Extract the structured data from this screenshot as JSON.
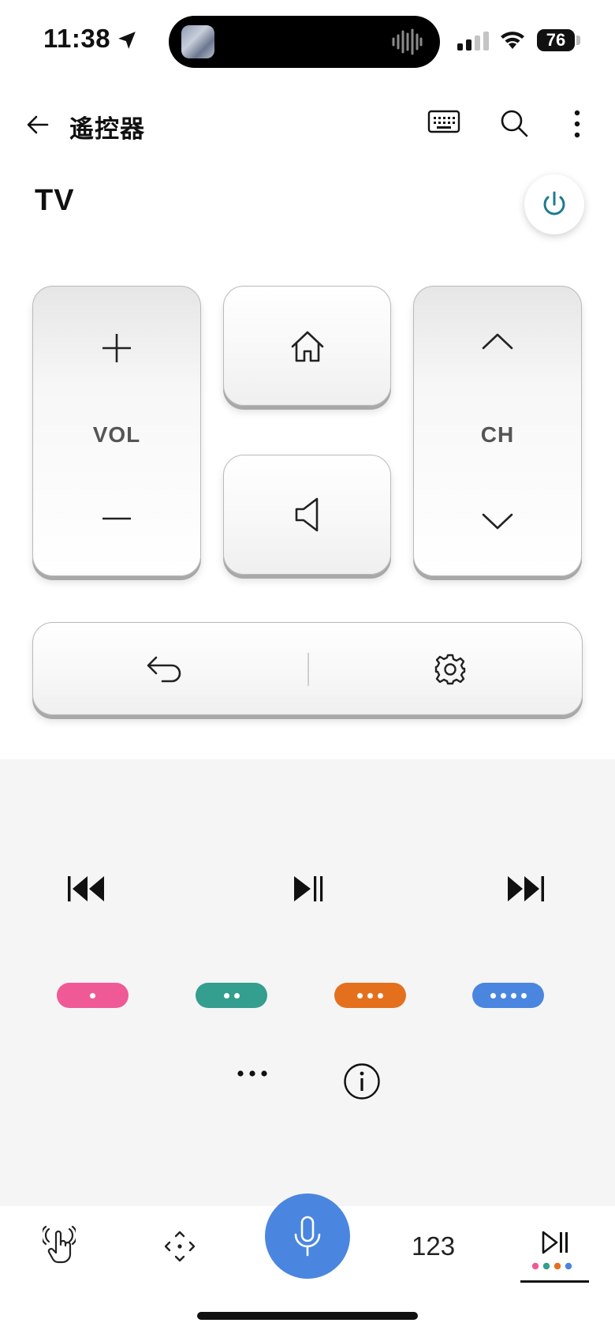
{
  "status_bar": {
    "time": "11:38",
    "battery": "76"
  },
  "header": {
    "title": "遙控器"
  },
  "device": {
    "name": "TV"
  },
  "keypad": {
    "vol_label": "VOL",
    "ch_label": "CH"
  },
  "colors": {
    "accent": "#4a86e0",
    "power": "#1f7a8c",
    "pill_red": "#ef5a96",
    "pill_green": "#349e8f",
    "pill_orange": "#e4701e",
    "pill_blue": "#4a86e0"
  },
  "color_buttons": [
    {
      "color": "#ef5a96",
      "dots": 1
    },
    {
      "color": "#349e8f",
      "dots": 2
    },
    {
      "color": "#e4701e",
      "dots": 3
    },
    {
      "color": "#4a86e0",
      "dots": 4
    }
  ],
  "tab_bar": {
    "number_tab_label": "123",
    "active_tab": "media"
  }
}
